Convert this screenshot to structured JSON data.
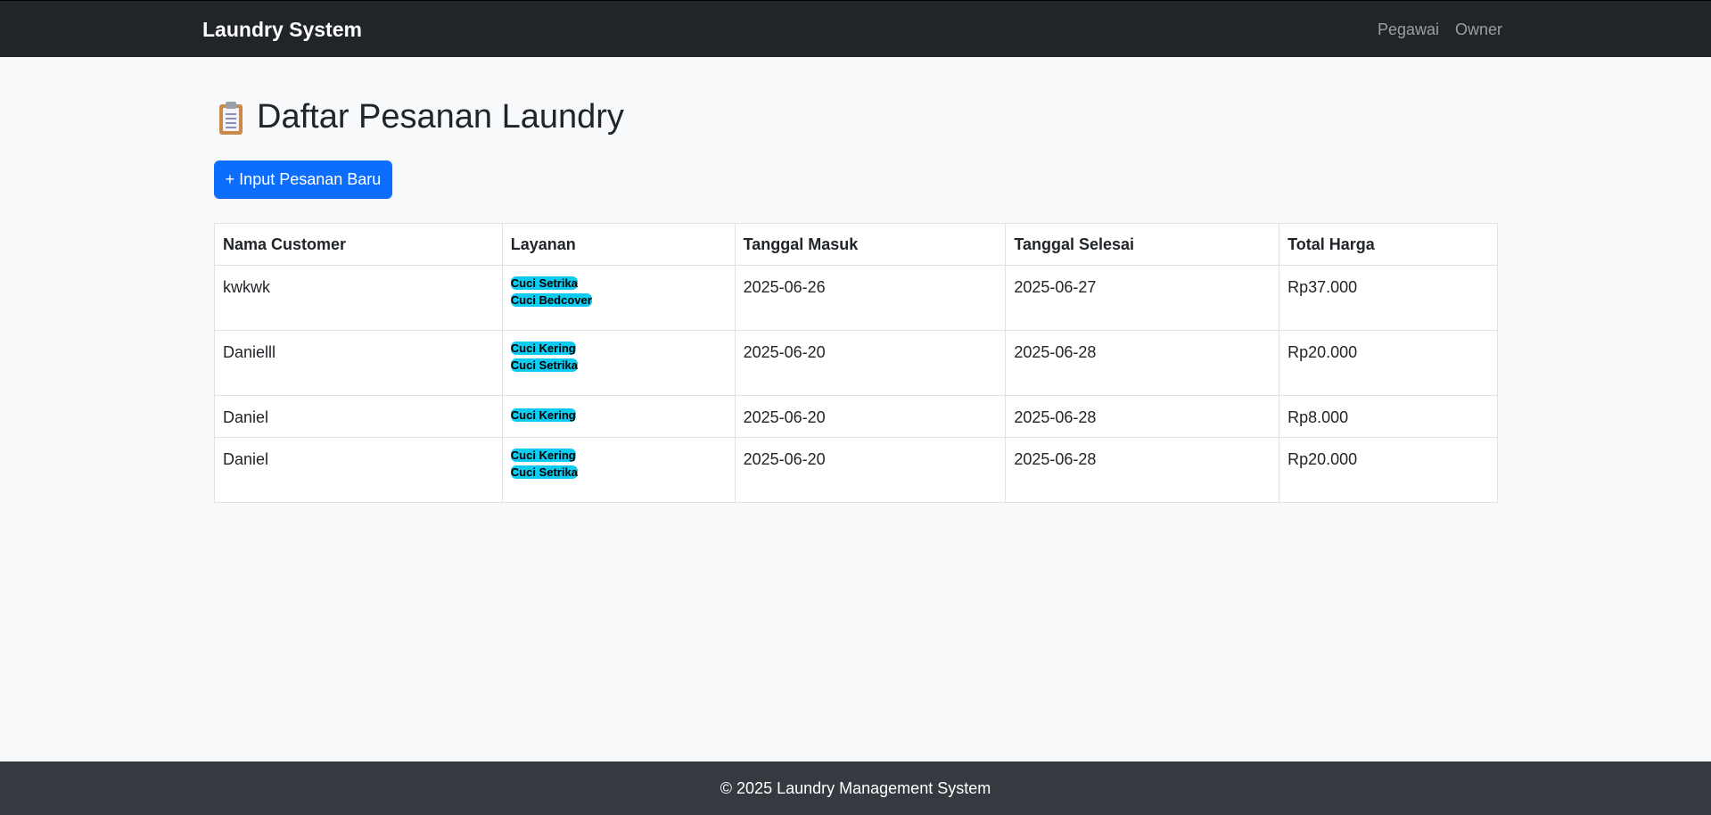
{
  "navbar": {
    "brand": "Laundry System",
    "links": [
      {
        "label": "Pegawai"
      },
      {
        "label": "Owner"
      }
    ]
  },
  "page": {
    "title": "Daftar Pesanan Laundry",
    "title_icon": "clipboard-icon",
    "new_order_button": "+ Input Pesanan Baru"
  },
  "table": {
    "headers": [
      "Nama Customer",
      "Layanan",
      "Tanggal Masuk",
      "Tanggal Selesai",
      "Total Harga"
    ],
    "rows": [
      {
        "customer": "kwkwk",
        "services": [
          "Cuci Setrika",
          "Cuci Bedcover"
        ],
        "date_in": "2025-06-26",
        "date_done": "2025-06-27",
        "total": "Rp37.000"
      },
      {
        "customer": "Danielll",
        "services": [
          "Cuci Kering",
          "Cuci Setrika"
        ],
        "date_in": "2025-06-20",
        "date_done": "2025-06-28",
        "total": "Rp20.000"
      },
      {
        "customer": "Daniel",
        "services": [
          "Cuci Kering"
        ],
        "date_in": "2025-06-20",
        "date_done": "2025-06-28",
        "total": "Rp8.000"
      },
      {
        "customer": "Daniel",
        "services": [
          "Cuci Kering",
          "Cuci Setrika"
        ],
        "date_in": "2025-06-20",
        "date_done": "2025-06-28",
        "total": "Rp20.000"
      }
    ]
  },
  "footer": {
    "text": "© 2025 Laundry Management System"
  },
  "colors": {
    "navbar_bg": "#212529",
    "primary": "#0d6efd",
    "badge": "#0dcaf0",
    "footer_bg": "#343a40"
  }
}
